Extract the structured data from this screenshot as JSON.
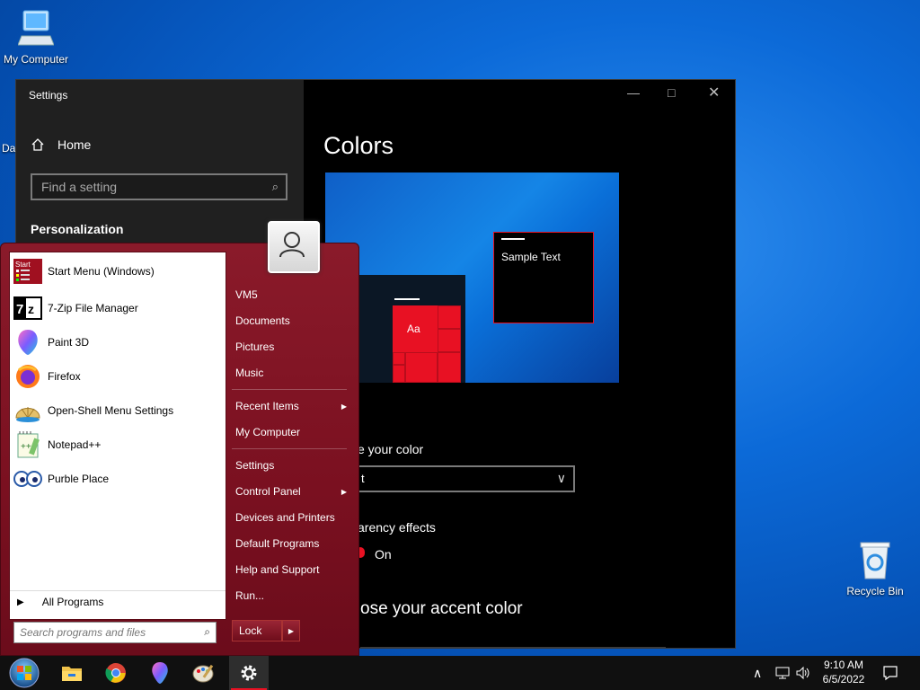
{
  "desktop": {
    "icons": [
      {
        "label": "My Computer",
        "icon": "computer-icon"
      },
      {
        "label": "Da",
        "icon": "partial-icon"
      },
      {
        "label": "Recycle Bin",
        "icon": "recycle-bin-icon"
      }
    ]
  },
  "settings": {
    "window_title": "Settings",
    "nav": {
      "home_label": "Home",
      "search_placeholder": "Find a setting",
      "section_label": "Personalization"
    },
    "page_title": "Colors",
    "preview": {
      "sample_text": "Sample Text",
      "tile_text": "Aa"
    },
    "choose_color_label": "e your color",
    "dropdown_value": "t",
    "transparency_label": "arency effects",
    "transparency_state": "On",
    "accent_heading": "ose your accent color",
    "accent_color": "#e81123"
  },
  "start_menu": {
    "pinned": [
      {
        "label": "Start Menu (Windows)",
        "icon": "start-menu-icon"
      },
      {
        "label": "7-Zip File Manager",
        "icon": "7zip-icon"
      },
      {
        "label": "Paint 3D",
        "icon": "paint3d-icon"
      },
      {
        "label": "Firefox",
        "icon": "firefox-icon"
      },
      {
        "label": "Open-Shell Menu Settings",
        "icon": "open-shell-icon"
      },
      {
        "label": "Notepad++",
        "icon": "notepadpp-icon"
      },
      {
        "label": "Purble Place",
        "icon": "purble-place-icon"
      }
    ],
    "all_programs": "All Programs",
    "search_placeholder": "Search programs and files",
    "right_pane": [
      {
        "label": "VM5"
      },
      {
        "label": "Documents"
      },
      {
        "label": "Pictures"
      },
      {
        "label": "Music"
      },
      {
        "label": "Recent Items",
        "submenu": true
      },
      {
        "label": "My Computer"
      },
      {
        "label": "Settings"
      },
      {
        "label": "Control Panel",
        "submenu": true
      },
      {
        "label": "Devices and Printers"
      },
      {
        "label": "Default Programs"
      },
      {
        "label": "Help and Support"
      },
      {
        "label": "Run..."
      }
    ],
    "lock_label": "Lock"
  },
  "taskbar": {
    "apps": [
      "start-orb",
      "file-explorer-icon",
      "chrome-icon",
      "paint3d-icon",
      "paint-icon",
      "settings-gear-icon"
    ],
    "active_app": "settings-gear-icon",
    "time": "9:10 AM",
    "date": "6/5/2022"
  }
}
